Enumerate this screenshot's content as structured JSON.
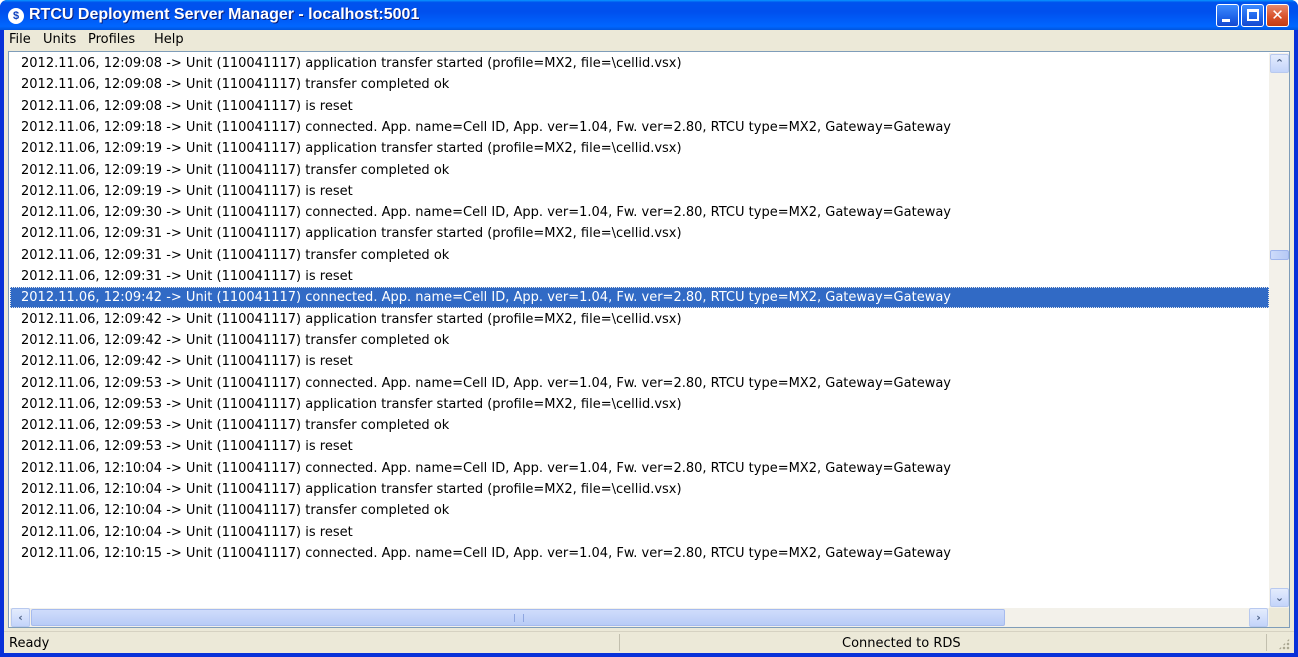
{
  "window": {
    "title": "RTCU Deployment Server Manager - localhost:5001",
    "icon_glyph": "$"
  },
  "title_buttons": {
    "minimize": "minimize-icon",
    "maximize": "maximize-icon",
    "close": "close-icon",
    "close_glyph": "✕"
  },
  "menu": {
    "file": "File",
    "units": "Units",
    "profiles": "Profiles",
    "help": "Help"
  },
  "log": {
    "selected_index": 11,
    "lines": [
      "2012.11.06, 12:09:08 -> Unit (110041117) application transfer started (profile=MX2, file=\\cellid.vsx)",
      "2012.11.06, 12:09:08 -> Unit (110041117) transfer completed ok",
      "2012.11.06, 12:09:08 -> Unit (110041117) is reset",
      "2012.11.06, 12:09:18 -> Unit (110041117) connected. App. name=Cell ID, App. ver=1.04, Fw. ver=2.80, RTCU type=MX2, Gateway=Gateway",
      "2012.11.06, 12:09:19 -> Unit (110041117) application transfer started (profile=MX2, file=\\cellid.vsx)",
      "2012.11.06, 12:09:19 -> Unit (110041117) transfer completed ok",
      "2012.11.06, 12:09:19 -> Unit (110041117) is reset",
      "2012.11.06, 12:09:30 -> Unit (110041117) connected. App. name=Cell ID, App. ver=1.04, Fw. ver=2.80, RTCU type=MX2, Gateway=Gateway",
      "2012.11.06, 12:09:31 -> Unit (110041117) application transfer started (profile=MX2, file=\\cellid.vsx)",
      "2012.11.06, 12:09:31 -> Unit (110041117) transfer completed ok",
      "2012.11.06, 12:09:31 -> Unit (110041117) is reset",
      "2012.11.06, 12:09:42 -> Unit (110041117) connected. App. name=Cell ID, App. ver=1.04, Fw. ver=2.80, RTCU type=MX2, Gateway=Gateway",
      "2012.11.06, 12:09:42 -> Unit (110041117) application transfer started (profile=MX2, file=\\cellid.vsx)",
      "2012.11.06, 12:09:42 -> Unit (110041117) transfer completed ok",
      "2012.11.06, 12:09:42 -> Unit (110041117) is reset",
      "2012.11.06, 12:09:53 -> Unit (110041117) connected. App. name=Cell ID, App. ver=1.04, Fw. ver=2.80, RTCU type=MX2, Gateway=Gateway",
      "2012.11.06, 12:09:53 -> Unit (110041117) application transfer started (profile=MX2, file=\\cellid.vsx)",
      "2012.11.06, 12:09:53 -> Unit (110041117) transfer completed ok",
      "2012.11.06, 12:09:53 -> Unit (110041117) is reset",
      "2012.11.06, 12:10:04 -> Unit (110041117) connected. App. name=Cell ID, App. ver=1.04, Fw. ver=2.80, RTCU type=MX2, Gateway=Gateway",
      "2012.11.06, 12:10:04 -> Unit (110041117) application transfer started (profile=MX2, file=\\cellid.vsx)",
      "2012.11.06, 12:10:04 -> Unit (110041117) transfer completed ok",
      "2012.11.06, 12:10:04 -> Unit (110041117) is reset",
      "2012.11.06, 12:10:15 -> Unit (110041117) connected. App. name=Cell ID, App. ver=1.04, Fw. ver=2.80, RTCU type=MX2, Gateway=Gateway"
    ]
  },
  "scrollbars": {
    "up_glyph": "⌃",
    "down_glyph": "⌄",
    "left_glyph": "‹",
    "right_glyph": "›"
  },
  "status": {
    "left": "Ready",
    "right": "Connected to RDS"
  },
  "colors": {
    "titlebar": "#0054e3",
    "selection": "#316ac5",
    "face": "#ece9d8",
    "close_button": "#d9532c"
  }
}
